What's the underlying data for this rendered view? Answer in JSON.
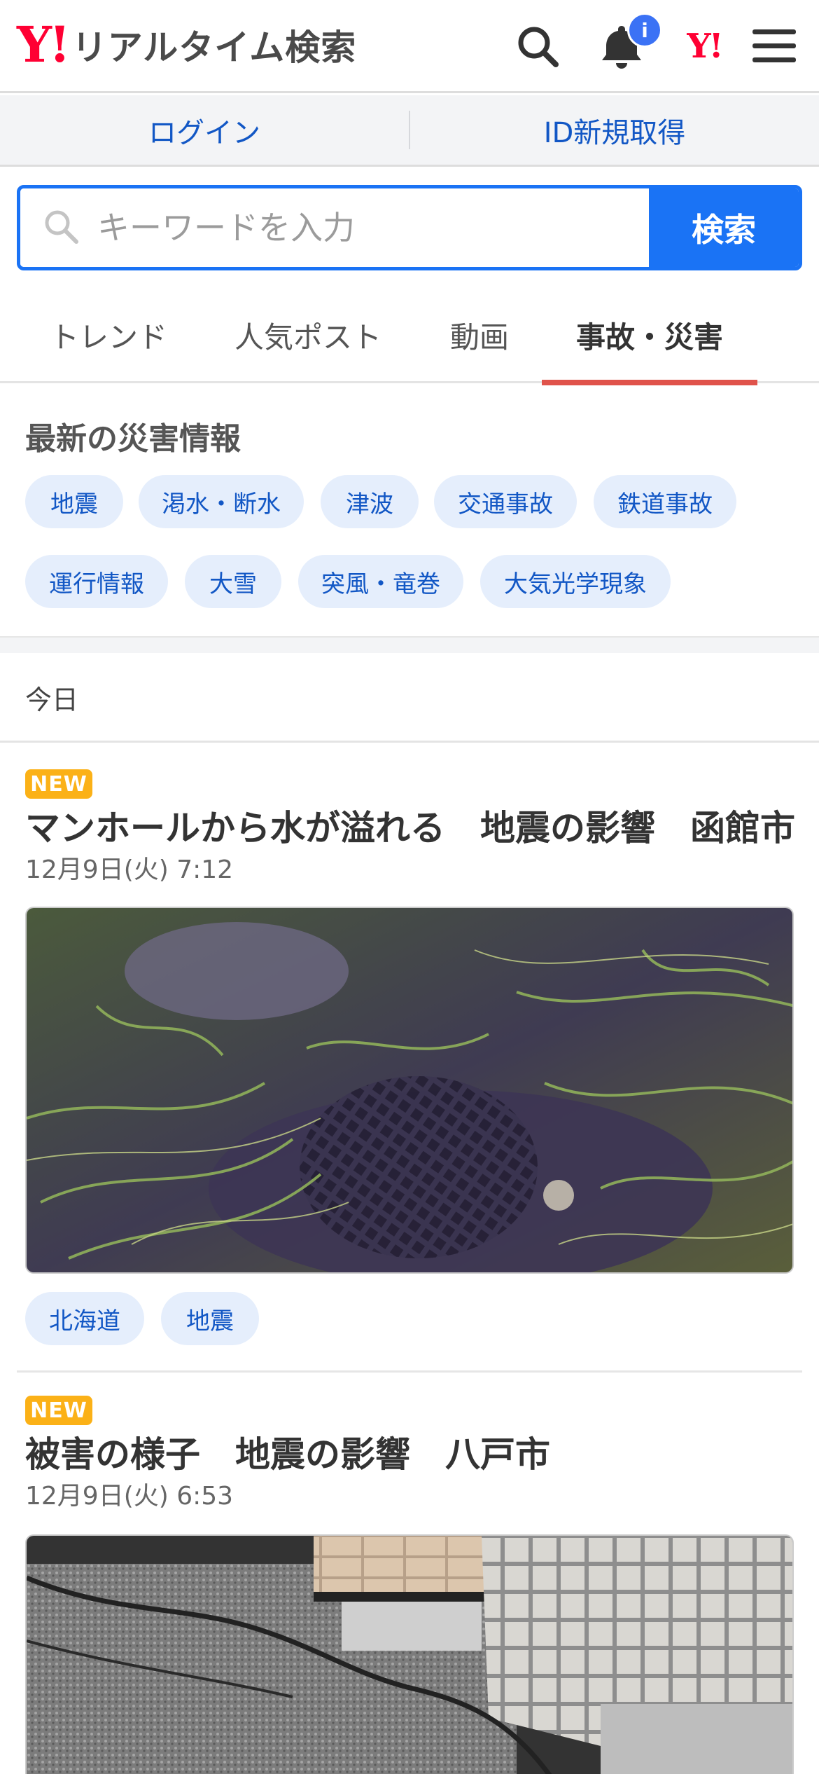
{
  "header": {
    "logo_mark": "Y!",
    "logo_text": "リアルタイム検索",
    "notification_badge": "i",
    "yj_mark": "Y!"
  },
  "login_bar": {
    "login": "ログイン",
    "register": "ID新規取得"
  },
  "search": {
    "placeholder": "キーワードを入力",
    "button": "検索"
  },
  "tabs": [
    {
      "label": "トレンド",
      "active": false
    },
    {
      "label": "人気ポスト",
      "active": false
    },
    {
      "label": "動画",
      "active": false
    },
    {
      "label": "事故・災害",
      "active": true
    }
  ],
  "disaster": {
    "title": "最新の災害情報",
    "chips": [
      "地震",
      "渇水・断水",
      "津波",
      "交通事故",
      "鉄道事故",
      "運行情報",
      "大雪",
      "突風・竜巻",
      "大気光学現象"
    ]
  },
  "today_label": "今日",
  "articles": [
    {
      "badge": "NEW",
      "title": "マンホールから水が溢れる　地震の影響　函館市",
      "date": "12月9日(火) 7:12",
      "image": "manhole-flooded-grass",
      "tags": [
        "北海道",
        "地震"
      ]
    },
    {
      "badge": "NEW",
      "title": "被害の様子　地震の影響　八戸市",
      "date": "12月9日(火) 6:53",
      "image": "cracked-ground-tiles",
      "tags": []
    }
  ],
  "colors": {
    "brand_red": "#ff0033",
    "accent_blue": "#1a73f5",
    "link_blue": "#1257c5",
    "chip_bg": "#e5eefc",
    "tab_active": "#e0534b",
    "new_badge": "#fbb117"
  }
}
